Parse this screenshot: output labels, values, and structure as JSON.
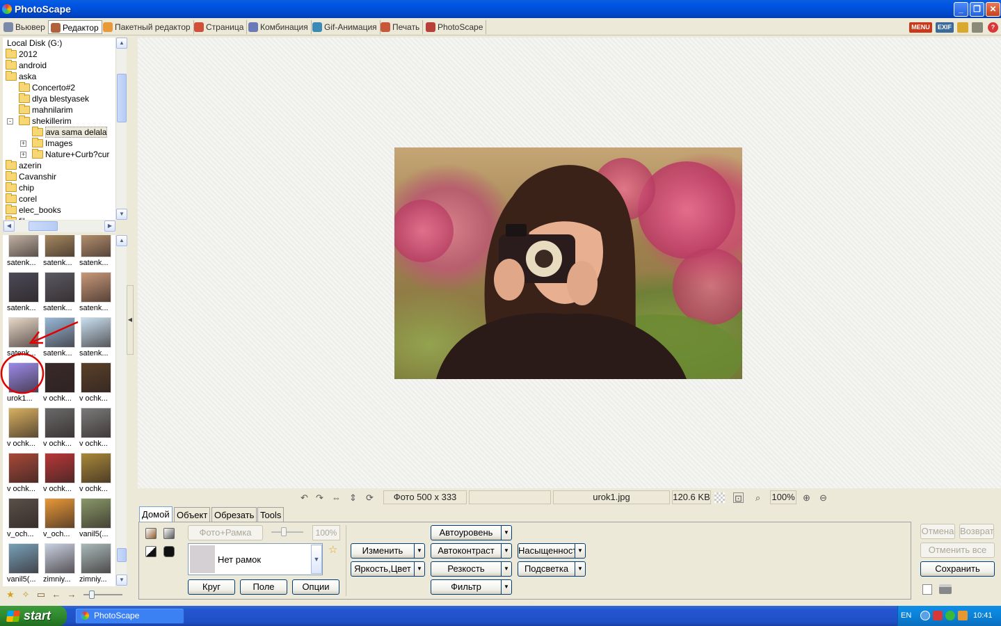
{
  "window": {
    "title": "PhotoScape"
  },
  "tabs": [
    {
      "label": "Вьювер",
      "color": "#7a8aa8"
    },
    {
      "label": "Редактор",
      "color": "#b0623a"
    },
    {
      "label": "Пакетный редактор",
      "color": "#e89a3a"
    },
    {
      "label": "Страница",
      "color": "#d0503a"
    },
    {
      "label": "Комбинация",
      "color": "#6a7ab8"
    },
    {
      "label": "Gif-Анимация",
      "color": "#3a8ab8"
    },
    {
      "label": "Печать",
      "color": "#c8583a"
    },
    {
      "label": "PhotoScape",
      "color": "#b8403a"
    }
  ],
  "toolbar_right": {
    "menu": "MENU",
    "exif": "EXIF"
  },
  "tree": {
    "items": [
      {
        "label": "Local Disk (G:)",
        "indent": 0
      },
      {
        "label": "2012",
        "indent": 1
      },
      {
        "label": "android",
        "indent": 1
      },
      {
        "label": "aska",
        "indent": 1
      },
      {
        "label": "Concerto#2",
        "indent": 2
      },
      {
        "label": "dlya blestyasek",
        "indent": 2
      },
      {
        "label": "mahnilarim",
        "indent": 2
      },
      {
        "label": "shekillerim",
        "indent": 2,
        "exp": "-"
      },
      {
        "label": "ava sama delala",
        "indent": 3,
        "selected": true
      },
      {
        "label": "Images",
        "indent": 3,
        "exp": "+"
      },
      {
        "label": "Nature+Curb?cur",
        "indent": 3,
        "exp": "+"
      },
      {
        "label": "azerin",
        "indent": 1
      },
      {
        "label": "Cavanshir",
        "indent": 1
      },
      {
        "label": "chip",
        "indent": 1
      },
      {
        "label": "corel",
        "indent": 1
      },
      {
        "label": "elec_books",
        "indent": 1
      },
      {
        "label": "fil...",
        "indent": 1
      }
    ]
  },
  "thumbnails": [
    {
      "caption": "satenk...",
      "color": "#d8c8b8"
    },
    {
      "caption": "satenk...",
      "color": "#b89868"
    },
    {
      "caption": "satenk...",
      "color": "#c8a078"
    },
    {
      "caption": "satenk...",
      "color": "#4a4a58"
    },
    {
      "caption": "satenk...",
      "color": "#5a5a62"
    },
    {
      "caption": "satenk...",
      "color": "#c89878"
    },
    {
      "caption": "satenk...",
      "color": "#e8d8c8"
    },
    {
      "caption": "satenk...",
      "color": "#98b8d8"
    },
    {
      "caption": "satenk...",
      "color": "#c8e0f0"
    },
    {
      "caption": "urok1...",
      "color": "#9a8ae8"
    },
    {
      "caption": "v ochk...",
      "color": "#3a2a2a"
    },
    {
      "caption": "v ochk...",
      "color": "#5a4028"
    },
    {
      "caption": "v ochk...",
      "color": "#d8b060"
    },
    {
      "caption": "v ochk...",
      "color": "#6a6a6a"
    },
    {
      "caption": "v ochk...",
      "color": "#7a7a7a"
    },
    {
      "caption": "v ochk...",
      "color": "#a84838"
    },
    {
      "caption": "v ochk...",
      "color": "#b83838"
    },
    {
      "caption": "v ochk...",
      "color": "#a88838"
    },
    {
      "caption": "v_och...",
      "color": "#5a5048"
    },
    {
      "caption": "v_och...",
      "color": "#e89838"
    },
    {
      "caption": "vanil5(...",
      "color": "#889868"
    },
    {
      "caption": "vanil5(...",
      "color": "#78a0b8"
    },
    {
      "caption": "zimniy...",
      "color": "#c8d0e0"
    },
    {
      "caption": "zimniy...",
      "color": "#a8b8b8"
    }
  ],
  "status": {
    "photo_size": "Фото 500 x 333",
    "empty": "",
    "filename": "urok1.jpg",
    "filesize": "120.6 KB",
    "zoom": "100%"
  },
  "editor_tabs": [
    "Домой",
    "Объект",
    "Обрезать",
    "Tools"
  ],
  "home_panel": {
    "photo_frame": "Фото+Рамка",
    "frame_percent": "100%",
    "frame_value": "Нет рамок",
    "circle": "Круг",
    "margin": "Поле",
    "options": "Опции",
    "resize": "Изменить",
    "brightness": "Яркость,Цвет",
    "autolevel": "Автоуровень",
    "autocontrast": "Автоконтраст",
    "sharpen": "Резкость",
    "filter": "Фильтр",
    "saturation": "Насыщенность",
    "backlight": "Подсветка",
    "undo": "Отмена",
    "redo": "Возврат",
    "undo_all": "Отменить все",
    "save": "Сохранить"
  },
  "taskbar": {
    "start": "start",
    "item": "PhotoScape",
    "lang": "EN",
    "time": "10:41"
  }
}
